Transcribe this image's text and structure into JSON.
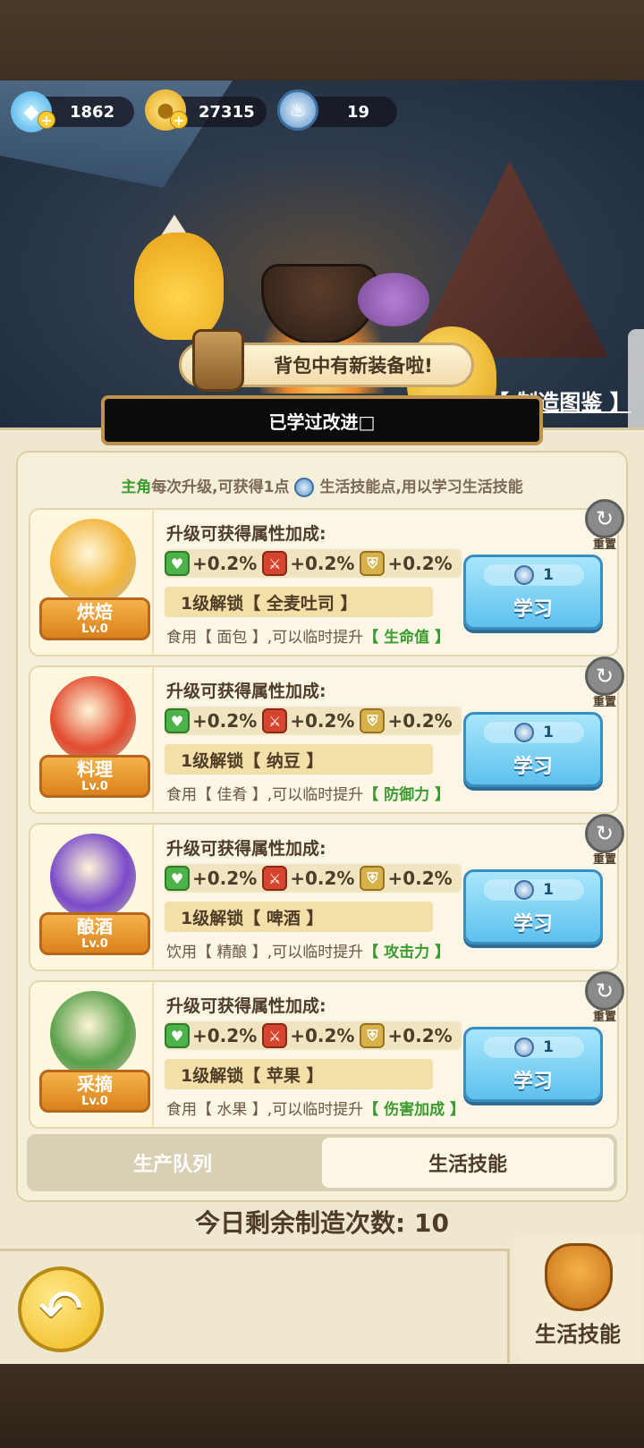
{
  "currencies": [
    {
      "icon": "diamond-icon",
      "value": "1862",
      "plus": "+"
    },
    {
      "icon": "gold-coin-icon",
      "value": "27315",
      "plus": "+"
    },
    {
      "icon": "chef-token-icon",
      "value": "19"
    }
  ],
  "scene": {
    "new_equipment_text": "背包中有新装备啦!",
    "codex_link": "【 制造图鉴 】"
  },
  "improved_tab_label": "已学过改进□",
  "hint": {
    "role": "主角",
    "part1": "每次升级,可获得1点",
    "part2": "生活技能点,用以学习生活技能"
  },
  "skills": [
    {
      "name": "烘焙",
      "level": "Lv.0",
      "attr_title": "升级可获得属性加成:",
      "hp": "+0.2%",
      "atk": "+0.2%",
      "def": "+0.2%",
      "unlock": "1级解锁【 全麦吐司 】",
      "eat_prefix": "食用【 面包 】,可以临时提升",
      "eat_stat": "【 生命值 】",
      "cost": "1",
      "learn": "学习",
      "reset": "重置",
      "portrait_color": "#f2b43a"
    },
    {
      "name": "料理",
      "level": "Lv.0",
      "attr_title": "升级可获得属性加成:",
      "hp": "+0.2%",
      "atk": "+0.2%",
      "def": "+0.2%",
      "unlock": "1级解锁【 纳豆 】",
      "eat_prefix": "食用【 佳肴 】,可以临时提升",
      "eat_stat": "【 防御力 】",
      "cost": "1",
      "learn": "学习",
      "reset": "重置",
      "portrait_color": "#e24a2e"
    },
    {
      "name": "酿酒",
      "level": "Lv.0",
      "attr_title": "升级可获得属性加成:",
      "hp": "+0.2%",
      "atk": "+0.2%",
      "def": "+0.2%",
      "unlock": "1级解锁【 啤酒 】",
      "eat_prefix": "饮用【 精酿 】,可以临时提升",
      "eat_stat": "【 攻击力 】",
      "cost": "1",
      "learn": "学习",
      "reset": "重置",
      "portrait_color": "#7a4ac8"
    },
    {
      "name": "采摘",
      "level": "Lv.0",
      "attr_title": "升级可获得属性加成:",
      "hp": "+0.2%",
      "atk": "+0.2%",
      "def": "+0.2%",
      "unlock": "1级解锁【 苹果 】",
      "eat_prefix": "食用【 水果 】,可以临时提升",
      "eat_stat": "【 伤害加成 】",
      "cost": "1",
      "learn": "学习",
      "reset": "重置",
      "portrait_color": "#5aa04a"
    }
  ],
  "tabs": {
    "queue": "生产队列",
    "life_skills": "生活技能"
  },
  "remaining": {
    "label": "今日剩余制造次数:",
    "count": "10"
  },
  "footer": {
    "life_skill_label": "生活技能"
  }
}
